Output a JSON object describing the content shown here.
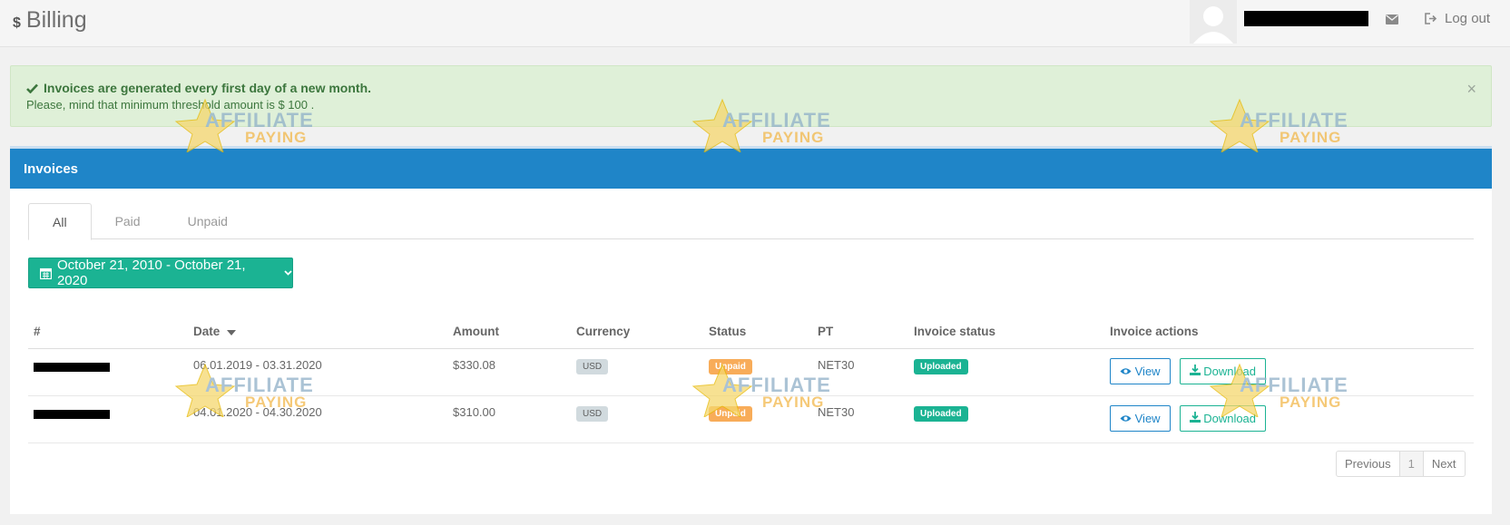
{
  "header": {
    "title_icon": "$",
    "title": "Billing",
    "logout_label": "Log out"
  },
  "alert": {
    "title": "Invoices are generated every first day of a new month.",
    "text": "Please, mind that minimum threshold amount is $ 100 .",
    "close": "×"
  },
  "panel": {
    "title": "Invoices",
    "tabs": [
      {
        "label": "All",
        "active": true
      },
      {
        "label": "Paid",
        "active": false
      },
      {
        "label": "Unpaid",
        "active": false
      }
    ],
    "date_range": "October 21, 2010 - October 21, 2020"
  },
  "table": {
    "columns": [
      "#",
      "Date",
      "Amount",
      "Currency",
      "Status",
      "PT",
      "Invoice status",
      "Invoice actions"
    ],
    "rows": [
      {
        "date": "06.01.2019 - 03.31.2020",
        "amount": "$330.08",
        "currency": "USD",
        "status": "Unpaid",
        "pt": "NET30",
        "invoice_status": "Uploaded",
        "view": "View",
        "download": "Download"
      },
      {
        "date": "04.01.2020 - 04.30.2020",
        "amount": "$310.00",
        "currency": "USD",
        "status": "Unpaid",
        "pt": "NET30",
        "invoice_status": "Uploaded",
        "view": "View",
        "download": "Download"
      }
    ]
  },
  "pagination": {
    "previous": "Previous",
    "current": "1",
    "next": "Next"
  },
  "watermark": {
    "line1": "AFFILIATE",
    "line2": "PAYING"
  },
  "colors": {
    "primary": "#1f85c8",
    "success": "#1bb393",
    "warning": "#f8ac59",
    "alert_bg": "#dff0d8"
  }
}
